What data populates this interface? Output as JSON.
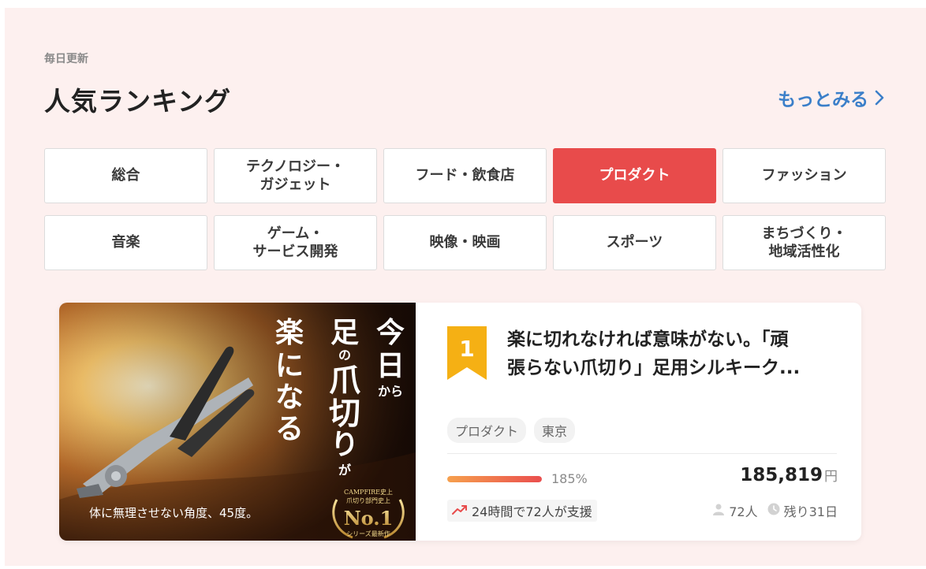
{
  "header": {
    "eyebrow": "毎日更新",
    "title": "人気ランキング",
    "more_label": "もっとみる"
  },
  "categories": [
    {
      "label": "総合",
      "active": false
    },
    {
      "label": "テクノロジー・\nガジェット",
      "active": false
    },
    {
      "label": "フード・飲食店",
      "active": false
    },
    {
      "label": "プロダクト",
      "active": true
    },
    {
      "label": "ファッション",
      "active": false
    },
    {
      "label": "音楽",
      "active": false
    },
    {
      "label": "ゲーム・\nサービス開発",
      "active": false
    },
    {
      "label": "映像・映画",
      "active": false
    },
    {
      "label": "スポーツ",
      "active": false
    },
    {
      "label": "まちづくり・\n地域活性化",
      "active": false
    }
  ],
  "project": {
    "rank": "1",
    "title_line1": "楽に切れなければ意味がない。「頑",
    "title_line2": "張らない爪切り」足用シルキーク...",
    "tags": [
      "プロダクト",
      "東京"
    ],
    "progress_percent": 185,
    "percent_label": "185%",
    "amount": "185,819",
    "amount_unit": "円",
    "support_text": "24時間で72人が支援",
    "backers": "72人",
    "days_left": "残り31日",
    "image": {
      "headline": "今日から足の爪切りが楽になる",
      "caption": "体に無理させない角度、45度。",
      "award_line1": "CAMPFIRE史上",
      "award_line2": "爪切り部門史上",
      "award_main": "No.1",
      "award_sub": "シリーズ最新作"
    }
  },
  "colors": {
    "accent": "#e84b4b",
    "link": "#3b7fc9",
    "rank_badge": "#f5b014",
    "section_bg": "#fdf0ef"
  }
}
